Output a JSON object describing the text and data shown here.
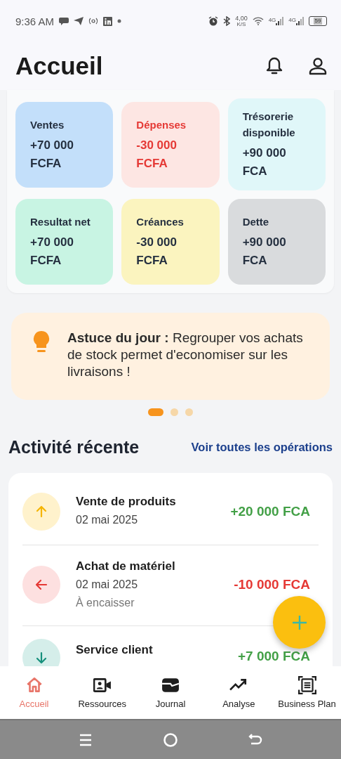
{
  "status_bar": {
    "time": "9:36 AM",
    "speed": "4,00",
    "speed_unit": "K/S",
    "networks": [
      "4G",
      "4G"
    ],
    "battery": "59"
  },
  "header": {
    "title": "Accueil"
  },
  "stats": [
    {
      "label": "Ventes",
      "amount": "+70 000",
      "currency": "FCFA",
      "color": "#c3dffa",
      "kind": "normal"
    },
    {
      "label": "Dépenses",
      "amount": "-30 000",
      "currency": "FCFA",
      "color": "#fde6e3",
      "kind": "expense"
    },
    {
      "label": "Trésorerie disponible",
      "amount": "+90 000",
      "currency": "FCA",
      "color": "#e0f7f9",
      "kind": "normal"
    },
    {
      "label": "Resultat net",
      "amount": "+70 000",
      "currency": "FCFA",
      "color": "#c8f4e3",
      "kind": "normal"
    },
    {
      "label": "Créances",
      "amount": "-30 000",
      "currency": "FCFA",
      "color": "#fbf4bf",
      "kind": "normal"
    },
    {
      "label": "Dette",
      "amount": "+90 000",
      "currency": "FCA",
      "color": "#d9dbdd",
      "kind": "normal"
    }
  ],
  "tip": {
    "text": "**Astuce du jour :** Regrouper vos achats de stock permet d'economiser sur les livraisons !"
  },
  "carousel_dots": [
    {
      "selected": true
    },
    {
      "selected": false
    },
    {
      "selected": false
    }
  ],
  "recent": {
    "title": "Activité récente",
    "link": "Voir toutes les opérations"
  },
  "transactions": [
    {
      "kind": "up",
      "title": "Vente de produits",
      "date": "02 mai 2025",
      "amount": "+20 000 FCA",
      "color": "#43a047"
    },
    {
      "kind": "left",
      "title": "Achat de matériel",
      "date": "02 mai 2025",
      "note": "À encaisser",
      "amount": "-10 000 FCA",
      "color": "#e53935"
    },
    {
      "kind": "down",
      "title": "Service client",
      "amount": "+7 000 FCA",
      "color": "#43a047"
    }
  ],
  "nav": [
    {
      "label": "Accueil",
      "selected": true
    },
    {
      "label": "Ressources",
      "selected": false
    },
    {
      "label": "Journal",
      "selected": false
    },
    {
      "label": "Analyse",
      "selected": false
    },
    {
      "label": "Business Plan",
      "selected": false
    }
  ]
}
